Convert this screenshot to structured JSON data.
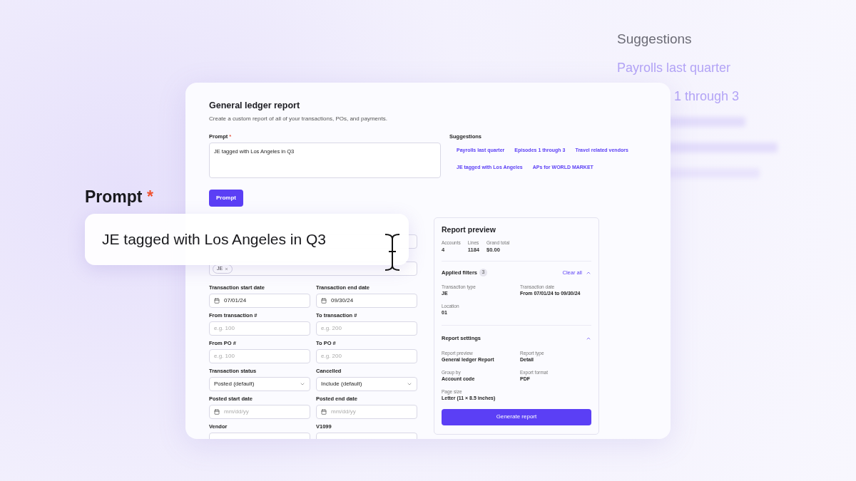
{
  "background_suggestions": {
    "title": "Suggestions",
    "items": [
      {
        "text": "Payrolls last quarter",
        "kind": "full"
      },
      {
        "text": "1 through 3",
        "kind": "partly_covered"
      }
    ]
  },
  "report": {
    "title": "General ledger report",
    "subtitle": "Create a custom report of all of your transactions, POs, and payments.",
    "prompt": {
      "label": "Prompt",
      "required_marker": "*",
      "value": "JE tagged with Los Angeles in Q3"
    },
    "prompt_button": "Prompt",
    "suggestions": {
      "title": "Suggestions",
      "items": [
        "Payrolls last quarter",
        "Episodes 1 through 3",
        "Travel related vendors",
        "JE tagged with Los Angeles",
        "APs for WORLD MARKET"
      ]
    },
    "transaction_type_chips": [
      "JE"
    ],
    "fields": [
      {
        "label": "Transaction start date",
        "kind": "date",
        "value": "07/01/24"
      },
      {
        "label": "Transaction end date",
        "kind": "date",
        "value": "09/30/24"
      },
      {
        "label": "From transaction #",
        "kind": "text",
        "placeholder": "e.g. 100"
      },
      {
        "label": "To transaction #",
        "kind": "text",
        "placeholder": "e.g. 200"
      },
      {
        "label": "From PO #",
        "kind": "text",
        "placeholder": "e.g. 100"
      },
      {
        "label": "To PO #",
        "kind": "text",
        "placeholder": "e.g. 200"
      },
      {
        "label": "Transaction status",
        "kind": "select",
        "value": "Posted (default)"
      },
      {
        "label": "Cancelled",
        "kind": "select",
        "value": "Include (default)"
      },
      {
        "label": "Posted start date",
        "kind": "date",
        "placeholder": "mm/dd/yy"
      },
      {
        "label": "Posted end date",
        "kind": "date",
        "placeholder": "mm/dd/yy"
      },
      {
        "label": "Vendor",
        "kind": "text"
      },
      {
        "label": "V1099",
        "kind": "text"
      }
    ],
    "preview": {
      "title": "Report preview",
      "stats": [
        {
          "label": "Accounts",
          "value": "4"
        },
        {
          "label": "Lines",
          "value": "1184"
        },
        {
          "label": "Grand total",
          "value": "$0.00"
        }
      ],
      "applied_filters": {
        "title": "Applied filters",
        "count": "3",
        "action": "Clear all",
        "expanded": true,
        "items": [
          {
            "label": "Transaction type",
            "value": "JE"
          },
          {
            "label": "Transaction date",
            "value": "From 07/01/24 to 09/30/24"
          },
          {
            "label": "Location",
            "value": "01"
          }
        ]
      },
      "settings": {
        "title": "Report settings",
        "expanded": true,
        "items": [
          {
            "label": "Report preview",
            "value": "General ledger Report"
          },
          {
            "label": "Report type",
            "value": "Detail"
          },
          {
            "label": "Group by",
            "value": "Account code"
          },
          {
            "label": "Export format",
            "value": "PDF"
          },
          {
            "label": "Page size",
            "value": "Letter (11 × 8.5 inches)"
          }
        ]
      },
      "button": "Generate report"
    }
  },
  "overlay": {
    "label": "Prompt",
    "required_marker": "*",
    "value": "JE tagged with Los Angeles in Q3"
  }
}
